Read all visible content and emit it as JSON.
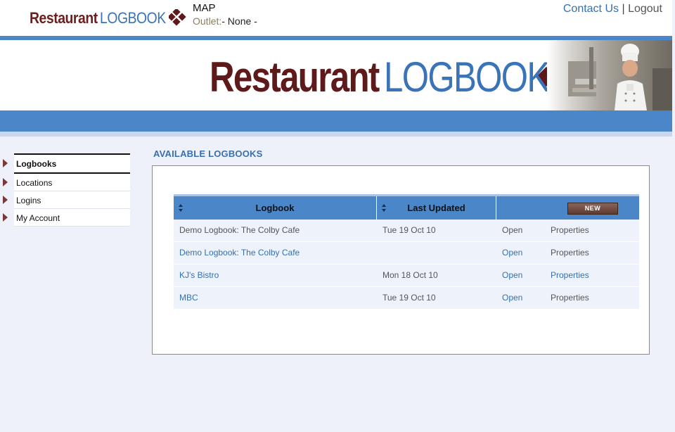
{
  "header": {
    "logo_left": "Restaurant",
    "logo_right": "LOGBOOK",
    "map_label": "MAP",
    "outlet_label": "Outlet:",
    "outlet_value": "- None -",
    "contact_label": "Contact Us",
    "separator": "|",
    "logout_label": "Logout"
  },
  "banner": {
    "logo_left": "Restaurant",
    "logo_right": "LOGBOOK"
  },
  "sidebar": {
    "items": [
      {
        "label": "Logbooks",
        "active": true
      },
      {
        "label": "Locations",
        "active": false
      },
      {
        "label": "Logins",
        "active": false
      },
      {
        "label": "My Account",
        "active": false
      }
    ]
  },
  "main": {
    "section_title": "AVAILABLE LOGBOOKS",
    "table": {
      "columns": [
        "Logbook",
        "Last Updated"
      ],
      "new_button": "NEW",
      "rows": [
        {
          "name": "Demo Logbook: The Colby Cafe",
          "name_link": false,
          "date": "Tue 19 Oct 10",
          "open": "Open",
          "open_link": false,
          "properties": "Properties",
          "properties_link": false
        },
        {
          "name": "Demo Logbook: The Colby Cafe",
          "name_link": true,
          "date": "",
          "open": "Open",
          "open_link": true,
          "properties": "Properties",
          "properties_link": false
        },
        {
          "name": "KJ's Bistro",
          "name_link": true,
          "date": "Mon 18 Oct 10",
          "open": "Open",
          "open_link": true,
          "properties": "Properties",
          "properties_link": true
        },
        {
          "name": "MBC",
          "name_link": true,
          "date": "Tue 19 Oct 10",
          "open": "Open",
          "open_link": true,
          "properties": "Properties",
          "properties_link": false
        }
      ]
    }
  },
  "colors": {
    "brand_maroon": "#5e1a1a",
    "brand_blue": "#3a74b8",
    "band_blue": "#4a86c8",
    "link_blue": "#3470b0"
  }
}
